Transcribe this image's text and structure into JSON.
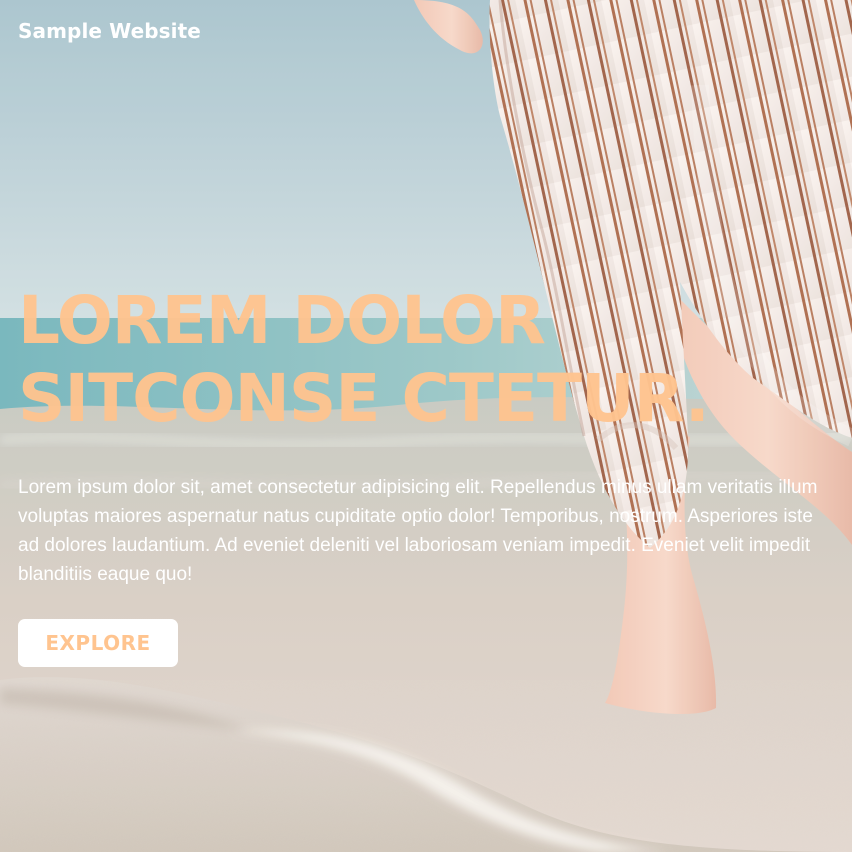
{
  "site": {
    "title": "Sample Website"
  },
  "hero": {
    "headline_line_1": "LOREM DOLOR",
    "headline_line_2": "SITCONSE CTETUR.",
    "body": "Lorem ipsum dolor sit, amet consectetur adipisicing elit. Repellendus minus ullam veritatis illum voluptas maiores aspernatur natus cupiditate optio dolor! Temporibus, nostrum. Asperiores iste ad dolores laudantium. Ad eveniet deleniti vel laboriosam veniam impedit. Eveniet velit impedit blanditiis eaque quo!",
    "button_label": "EXPLORE"
  },
  "colors": {
    "headline": "#ffc48f",
    "button_background": "#ffffff",
    "button_text": "#ffc48f",
    "site_title": "#ffffff",
    "body_text": "#ffffff"
  }
}
